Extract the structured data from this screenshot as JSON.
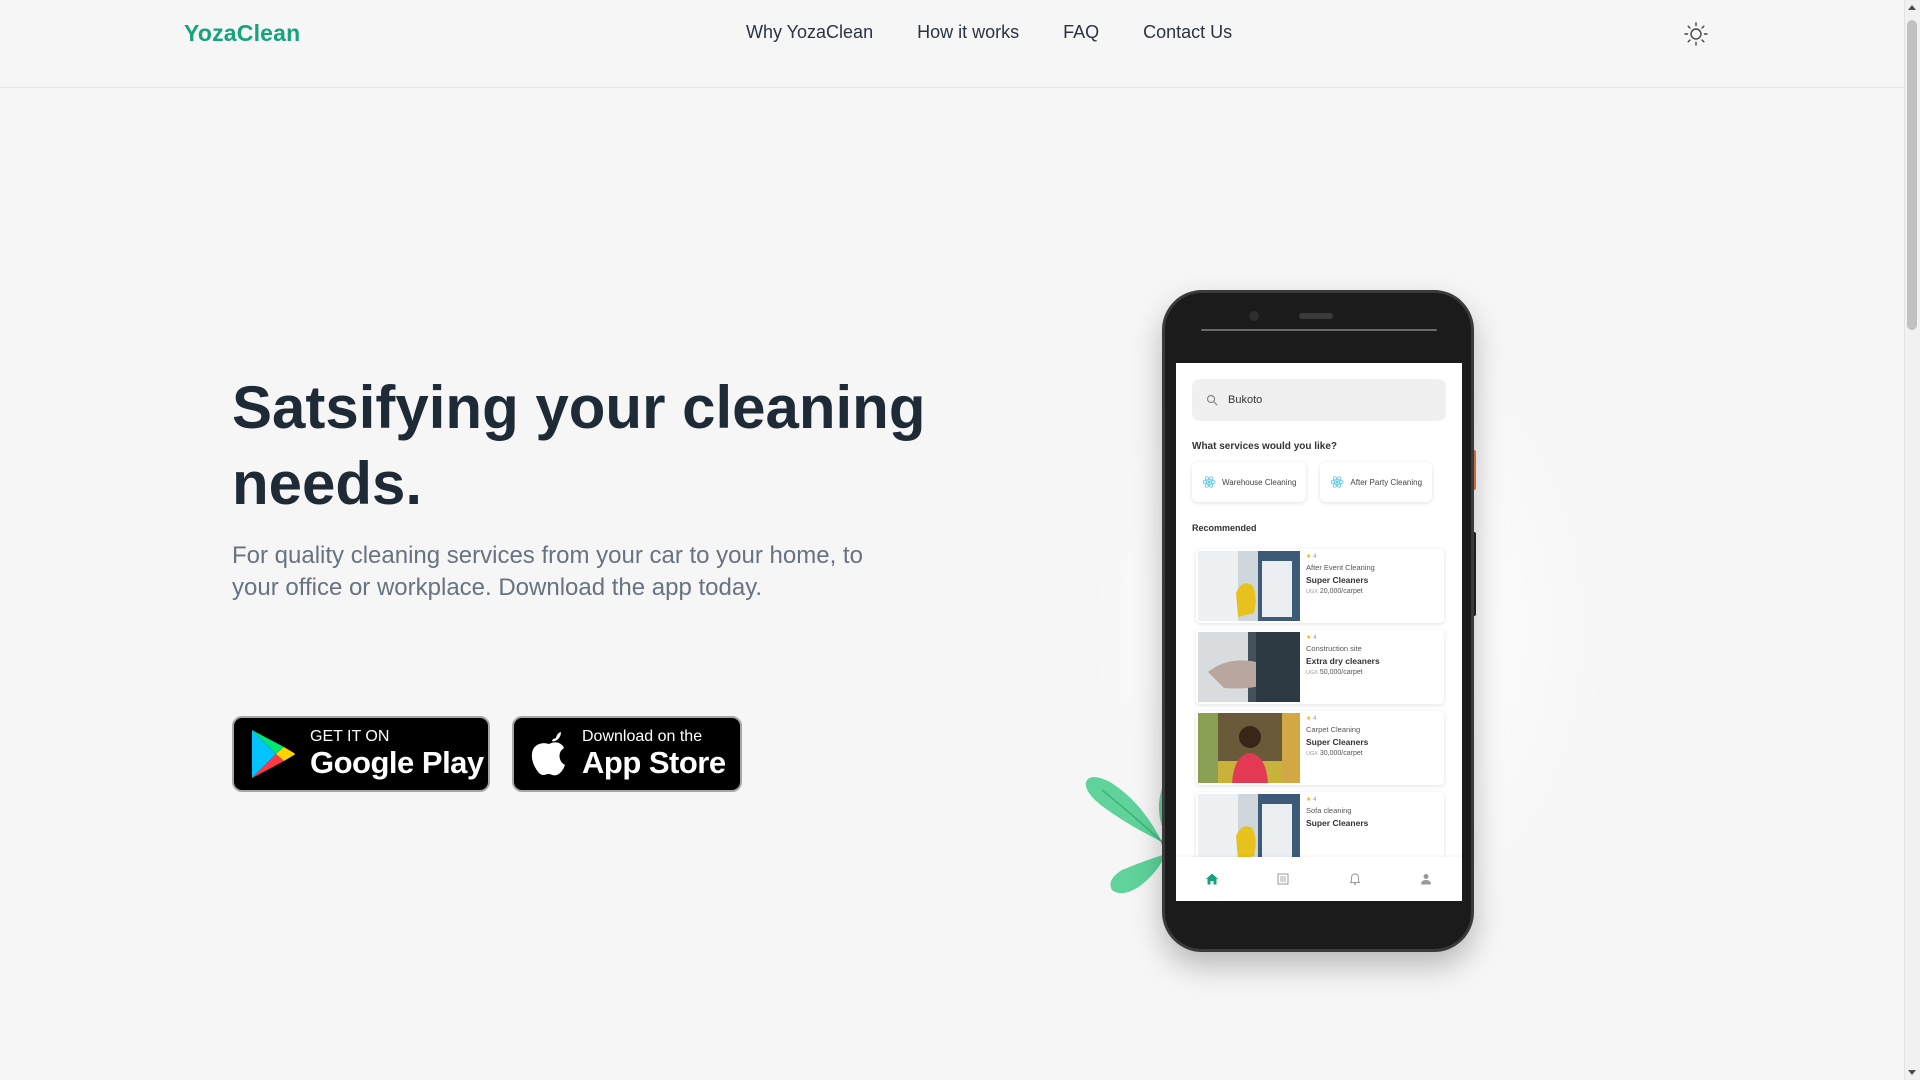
{
  "header": {
    "logo": "YozaClean",
    "nav": [
      "Why YozaClean",
      "How it works",
      "FAQ",
      "Contact Us"
    ],
    "theme_icon": "sun-icon"
  },
  "hero": {
    "title": "Satsifying your cleaning needs.",
    "subtitle": "For quality cleaning services from your car to your home, to your office or workplace. Download the app today."
  },
  "stores": {
    "google": {
      "small": "GET IT ON",
      "big": "Google Play"
    },
    "apple": {
      "small": "Download on the",
      "big": "App Store"
    }
  },
  "phone": {
    "search_value": "Bukoto",
    "services_question": "What services would you like?",
    "services": [
      "Warehouse  Cleaning",
      "After Party Cleaning"
    ],
    "recommended_label": "Recommended",
    "listings": [
      {
        "rating": "4",
        "service": "After Event Cleaning",
        "provider": "Super Cleaners",
        "currency": "UGX",
        "price": "20,000/carpet"
      },
      {
        "rating": "4",
        "service": "Construction site",
        "provider": "Extra dry cleaners",
        "currency": "UGX",
        "price": "50,000/carpet"
      },
      {
        "rating": "4",
        "service": "Carpet Cleaning",
        "provider": "Super Cleaners",
        "currency": "UGX",
        "price": "30,000/carpet"
      },
      {
        "rating": "4",
        "service": "Sofa cleaning",
        "provider": "Super Cleaners",
        "currency": "",
        "price": ""
      }
    ],
    "tabs": [
      "home-icon",
      "list-icon",
      "bell-icon",
      "user-icon"
    ]
  },
  "colors": {
    "brand": "#16a37c",
    "title": "#1f2a37",
    "subtitle": "#687280",
    "background": "#f6f6f6"
  }
}
